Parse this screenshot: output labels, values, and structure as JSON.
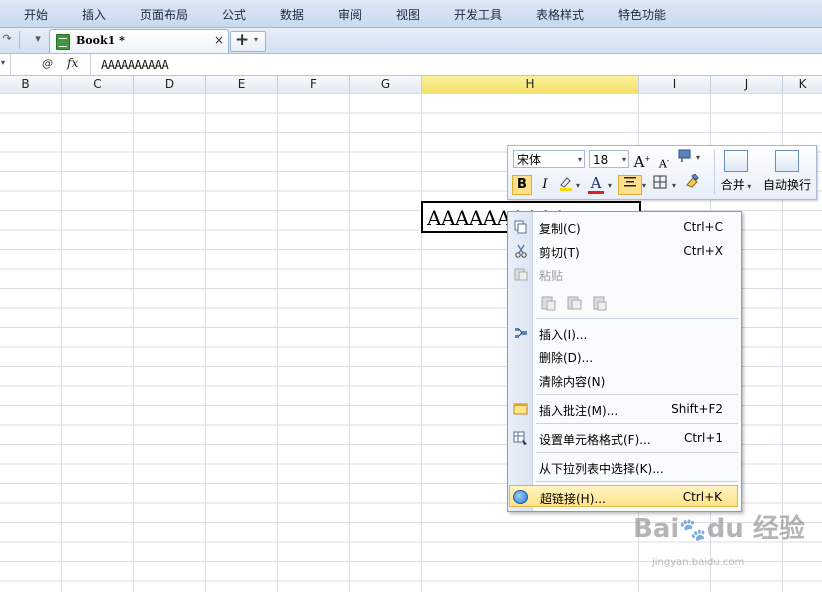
{
  "menu": {
    "items": [
      "开始",
      "插入",
      "页面布局",
      "公式",
      "数据",
      "审阅",
      "视图",
      "开发工具",
      "表格样式",
      "特色功能"
    ]
  },
  "tabbar": {
    "doc_title": "Book1 *",
    "close_glyph": "×",
    "new_tab_glyph": "+"
  },
  "formula_bar": {
    "fx_label": "fx",
    "content": "AAAAAAAAAA"
  },
  "columns": [
    "B",
    "C",
    "D",
    "E",
    "F",
    "G",
    "H",
    "I",
    "J",
    "K"
  ],
  "selected_column": "H",
  "active_cell": {
    "value": "AAAAAAAAAA"
  },
  "mini_toolbar": {
    "font_name": "宋体",
    "font_size": "18",
    "grow_font": "A",
    "shrink_font": "A",
    "bold": "B",
    "italic": "I",
    "font_color_glyph": "A",
    "merge_label": "合并",
    "wrap_label": "自动换行"
  },
  "context_menu": {
    "items": [
      {
        "label": "复制(C)",
        "shortcut": "Ctrl+C",
        "icon": "copy-icon"
      },
      {
        "label": "剪切(T)",
        "shortcut": "Ctrl+X",
        "icon": "scissors-icon"
      },
      {
        "label": "粘贴",
        "shortcut": "",
        "icon": "paste-icon",
        "disabled": true
      },
      {
        "label": "插入(I)...",
        "shortcut": "",
        "icon": "insert-icon"
      },
      {
        "label": "删除(D)...",
        "shortcut": "",
        "icon": ""
      },
      {
        "label": "清除内容(N)",
        "shortcut": "",
        "icon": ""
      },
      {
        "label": "插入批注(M)...",
        "shortcut": "Shift+F2",
        "icon": "comment-icon"
      },
      {
        "label": "设置单元格格式(F)...",
        "shortcut": "Ctrl+1",
        "icon": "format-cells-icon"
      },
      {
        "label": "从下拉列表中选择(K)...",
        "shortcut": "",
        "icon": ""
      },
      {
        "label": "超链接(H)...",
        "shortcut": "Ctrl+K",
        "icon": "hyperlink-icon",
        "highlighted": true
      }
    ]
  },
  "colors": {
    "selected_header": "#f3e16a",
    "highlight": "#ffe38a",
    "ribbon": "#c8d9ee"
  }
}
